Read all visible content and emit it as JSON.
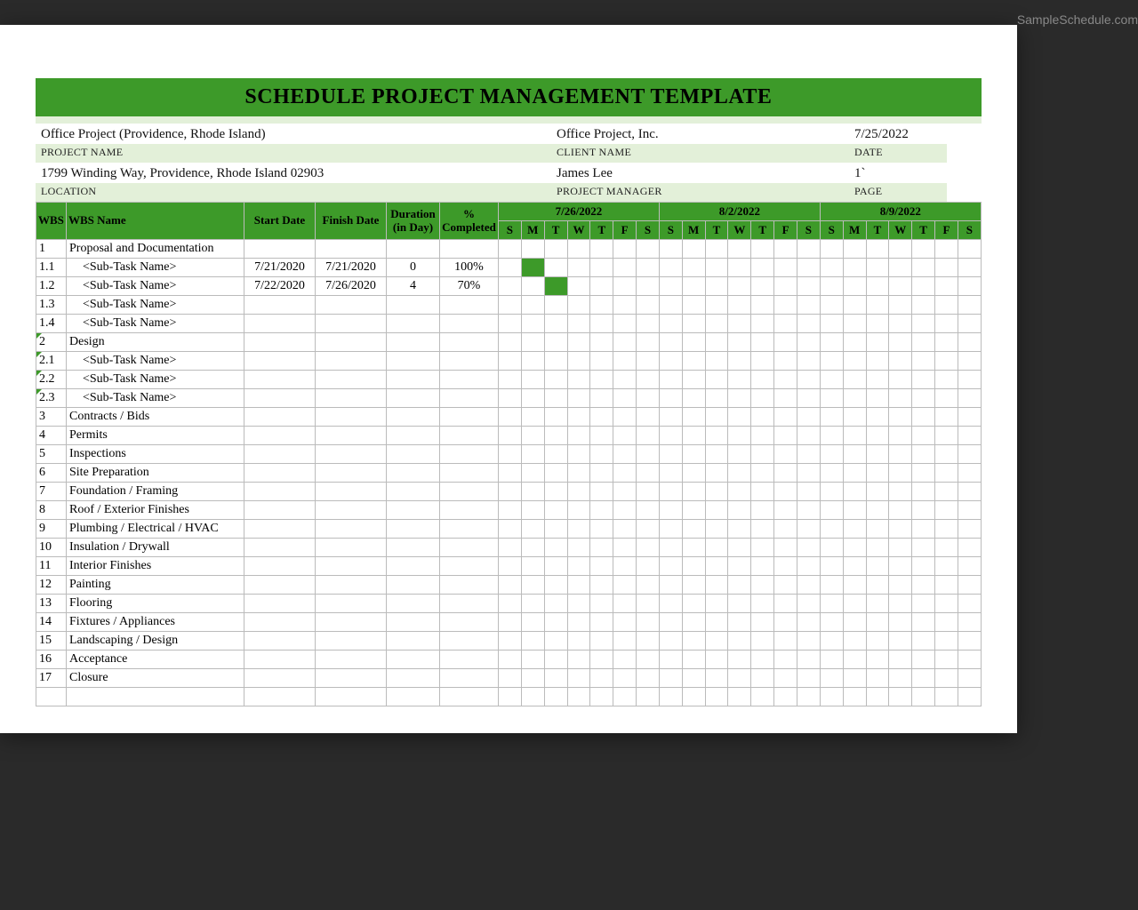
{
  "title": "SCHEDULE PROJECT MANAGEMENT  TEMPLATE",
  "info": {
    "project_name": {
      "value": "Office Project (Providence, Rhode Island)",
      "label": "PROJECT NAME"
    },
    "client_name": {
      "value": "Office Project, Inc.",
      "label": "CLIENT NAME"
    },
    "date": {
      "value": "7/25/2022",
      "label": "DATE"
    },
    "location": {
      "value": "1799  Winding Way, Providence, Rhode Island   02903",
      "label": "LOCATION"
    },
    "pm": {
      "value": "James Lee",
      "label": "PROJECT MANAGER"
    },
    "page": {
      "value": "1`",
      "label": "PAGE"
    }
  },
  "headers": {
    "wbs": "WBS",
    "wbs_name": "WBS Name",
    "start": "Start Date",
    "finish": "Finish Date",
    "duration": "Duration (in Day)",
    "pct": "% Completed"
  },
  "weeks": [
    {
      "label": "7/26/2022",
      "days": [
        "S",
        "M",
        "T",
        "W",
        "T",
        "F",
        "S"
      ]
    },
    {
      "label": "8/2/2022",
      "days": [
        "S",
        "M",
        "T",
        "W",
        "T",
        "F",
        "S"
      ]
    },
    {
      "label": "8/9/2022",
      "days": [
        "S",
        "M",
        "T",
        "W",
        "T",
        "F",
        "S"
      ]
    }
  ],
  "rows": [
    {
      "wbs": "1",
      "name": "Proposal and Documentation",
      "start": "",
      "finish": "",
      "dur": "",
      "pct": "",
      "indent": false,
      "fill": []
    },
    {
      "wbs": "1.1",
      "name": "<Sub-Task Name>",
      "start": "7/21/2020",
      "finish": "7/21/2020",
      "dur": "0",
      "pct": "100%",
      "indent": true,
      "fill": [
        1
      ]
    },
    {
      "wbs": "1.2",
      "name": "<Sub-Task Name>",
      "start": "7/22/2020",
      "finish": "7/26/2020",
      "dur": "4",
      "pct": "70%",
      "indent": true,
      "fill": [
        2
      ]
    },
    {
      "wbs": "1.3",
      "name": "<Sub-Task Name>",
      "start": "",
      "finish": "",
      "dur": "",
      "pct": "",
      "indent": true,
      "fill": []
    },
    {
      "wbs": "1.4",
      "name": "<Sub-Task Name>",
      "start": "",
      "finish": "",
      "dur": "",
      "pct": "",
      "indent": true,
      "fill": []
    },
    {
      "wbs": "2",
      "name": "Design",
      "start": "",
      "finish": "",
      "dur": "",
      "pct": "",
      "indent": false,
      "fill": [],
      "mark": true
    },
    {
      "wbs": "2.1",
      "name": "<Sub-Task Name>",
      "start": "",
      "finish": "",
      "dur": "",
      "pct": "",
      "indent": true,
      "fill": [],
      "mark": true
    },
    {
      "wbs": "2.2",
      "name": "<Sub-Task Name>",
      "start": "",
      "finish": "",
      "dur": "",
      "pct": "",
      "indent": true,
      "fill": [],
      "mark": true
    },
    {
      "wbs": "2.3",
      "name": "<Sub-Task Name>",
      "start": "",
      "finish": "",
      "dur": "",
      "pct": "",
      "indent": true,
      "fill": [],
      "mark": true
    },
    {
      "wbs": "3",
      "name": "Contracts / Bids",
      "start": "",
      "finish": "",
      "dur": "",
      "pct": "",
      "indent": false,
      "fill": []
    },
    {
      "wbs": "4",
      "name": "Permits",
      "start": "",
      "finish": "",
      "dur": "",
      "pct": "",
      "indent": false,
      "fill": []
    },
    {
      "wbs": "5",
      "name": "Inspections",
      "start": "",
      "finish": "",
      "dur": "",
      "pct": "",
      "indent": false,
      "fill": []
    },
    {
      "wbs": "6",
      "name": "Site Preparation",
      "start": "",
      "finish": "",
      "dur": "",
      "pct": "",
      "indent": false,
      "fill": []
    },
    {
      "wbs": "7",
      "name": "Foundation / Framing",
      "start": "",
      "finish": "",
      "dur": "",
      "pct": "",
      "indent": false,
      "fill": []
    },
    {
      "wbs": "8",
      "name": "Roof / Exterior Finishes",
      "start": "",
      "finish": "",
      "dur": "",
      "pct": "",
      "indent": false,
      "fill": []
    },
    {
      "wbs": "9",
      "name": "Plumbing / Electrical / HVAC",
      "start": "",
      "finish": "",
      "dur": "",
      "pct": "",
      "indent": false,
      "fill": []
    },
    {
      "wbs": "10",
      "name": "Insulation / Drywall",
      "start": "",
      "finish": "",
      "dur": "",
      "pct": "",
      "indent": false,
      "fill": []
    },
    {
      "wbs": "11",
      "name": "Interior Finishes",
      "start": "",
      "finish": "",
      "dur": "",
      "pct": "",
      "indent": false,
      "fill": []
    },
    {
      "wbs": "12",
      "name": "Painting",
      "start": "",
      "finish": "",
      "dur": "",
      "pct": "",
      "indent": false,
      "fill": []
    },
    {
      "wbs": "13",
      "name": "Flooring",
      "start": "",
      "finish": "",
      "dur": "",
      "pct": "",
      "indent": false,
      "fill": []
    },
    {
      "wbs": "14",
      "name": "Fixtures / Appliances",
      "start": "",
      "finish": "",
      "dur": "",
      "pct": "",
      "indent": false,
      "fill": []
    },
    {
      "wbs": "15",
      "name": "Landscaping / Design",
      "start": "",
      "finish": "",
      "dur": "",
      "pct": "",
      "indent": false,
      "fill": []
    },
    {
      "wbs": "16",
      "name": "Acceptance",
      "start": "",
      "finish": "",
      "dur": "",
      "pct": "",
      "indent": false,
      "fill": []
    },
    {
      "wbs": "17",
      "name": "Closure",
      "start": "",
      "finish": "",
      "dur": "",
      "pct": "",
      "indent": false,
      "fill": []
    },
    {
      "wbs": "",
      "name": "",
      "start": "",
      "finish": "",
      "dur": "",
      "pct": "",
      "indent": false,
      "fill": []
    }
  ],
  "footer": "SampleSchedule.com"
}
